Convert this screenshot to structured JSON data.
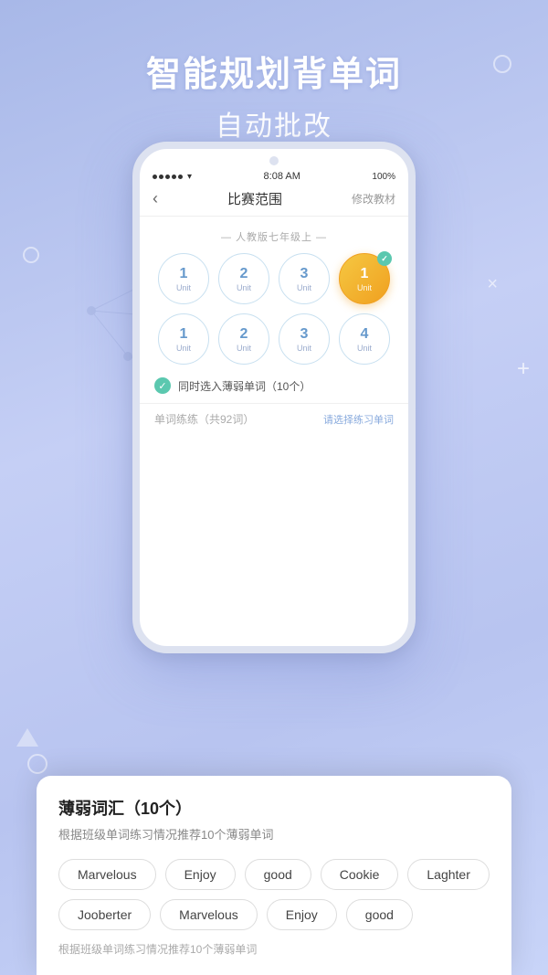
{
  "background": {
    "gradient_start": "#a8b8e8",
    "gradient_end": "#c8d4f8"
  },
  "title": {
    "main": "智能规划背单词",
    "sub": "自动批改"
  },
  "status_bar": {
    "signal": "●●●●●",
    "wifi": "WiFi",
    "time": "8:08 AM",
    "battery": "100%"
  },
  "nav": {
    "back_icon": "‹",
    "title": "比赛范围",
    "action": "修改教材"
  },
  "section": {
    "label": "— 人教版七年级上 —"
  },
  "units_row1": [
    {
      "number": "1",
      "label": "Unit",
      "selected": false
    },
    {
      "number": "2",
      "label": "Unit",
      "selected": false
    },
    {
      "number": "3",
      "label": "Unit",
      "selected": false
    },
    {
      "number": "1",
      "label": "Unit",
      "selected": true
    }
  ],
  "units_row2": [
    {
      "number": "1",
      "label": "Unit",
      "selected": false
    },
    {
      "number": "2",
      "label": "Unit",
      "selected": false
    },
    {
      "number": "3",
      "label": "Unit",
      "selected": false
    },
    {
      "number": "4",
      "label": "Unit",
      "selected": false
    }
  ],
  "checkbox": {
    "text": "同时选入薄弱单词（10个）"
  },
  "word_count": {
    "text": "单词练练（共92词）",
    "action": "请选择练习单词"
  },
  "bottom_sheet": {
    "title": "薄弱词汇（10个）",
    "subtitle": "根据班级单词练习情况推荐10个薄弱单词",
    "words": [
      "Marvelous",
      "Enjoy",
      "good",
      "Cookie",
      "Laghter",
      "Jooberter",
      "Marvelous",
      "Enjoy",
      "good"
    ],
    "footer": "根据班级单词练习情况推荐10个薄弱单词"
  }
}
